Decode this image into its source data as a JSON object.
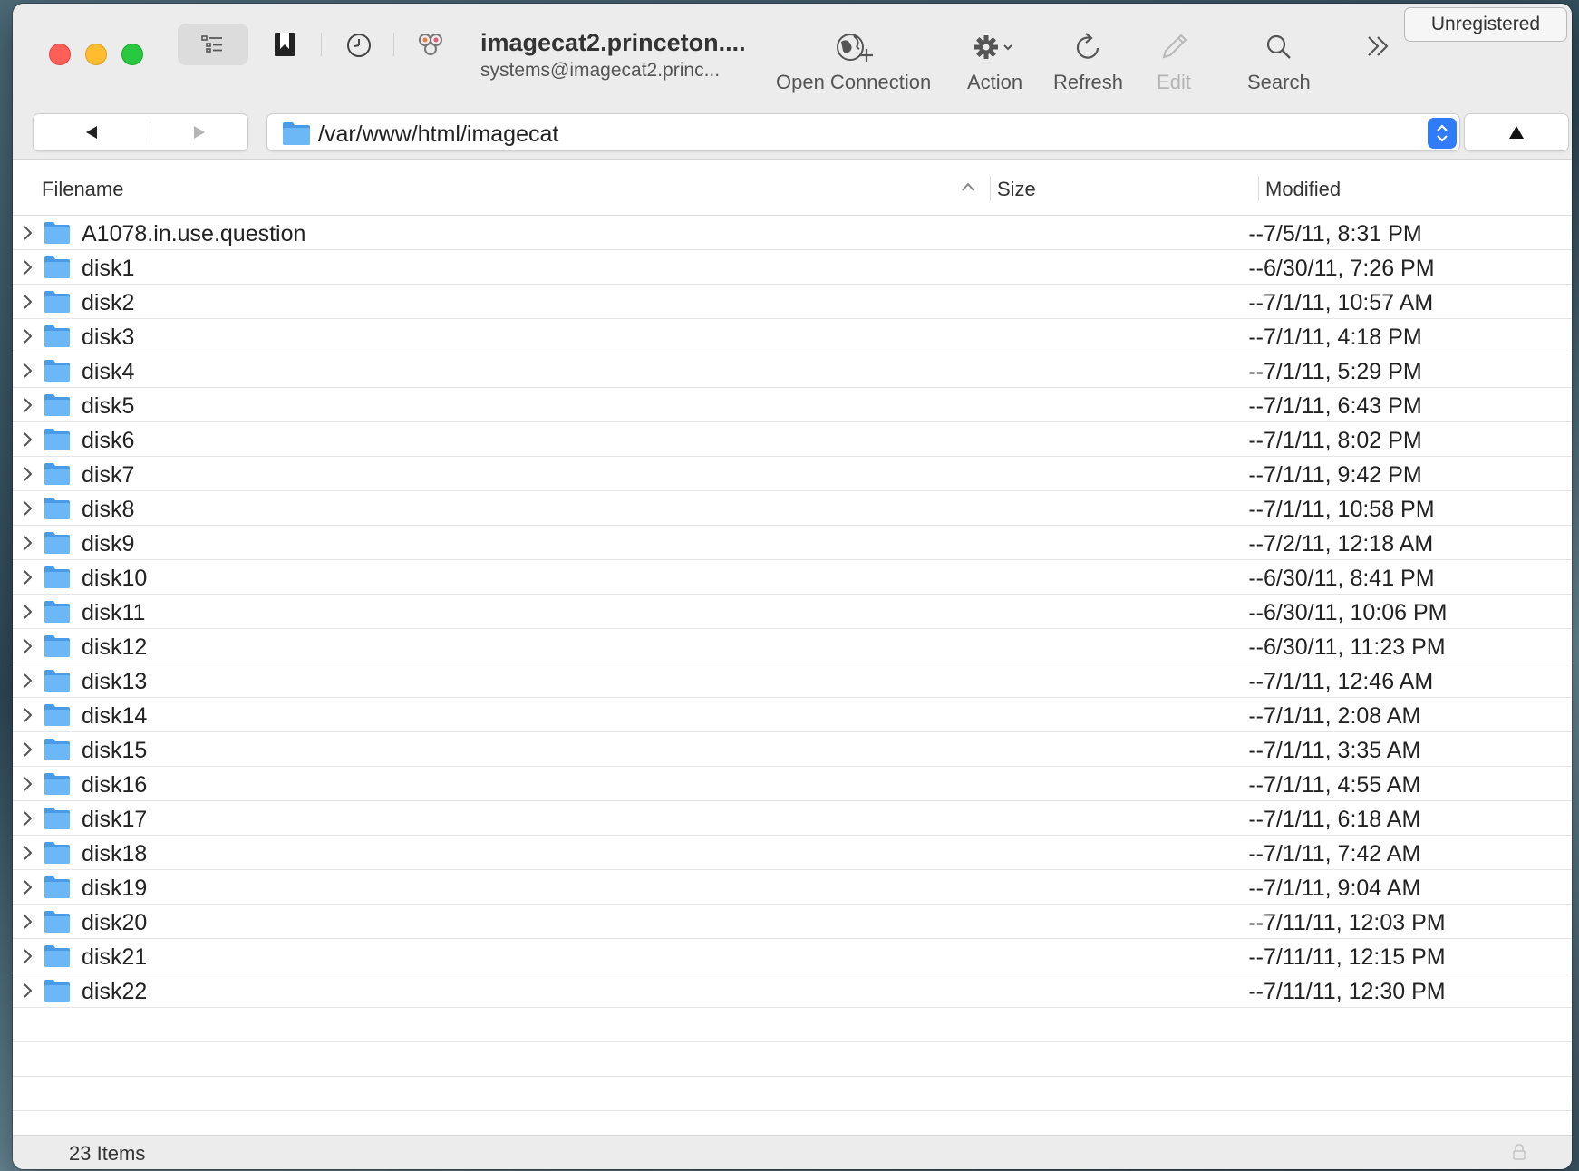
{
  "toolbar": {
    "connection_title": "imagecat2.princeton....",
    "connection_subtitle": "systems@imagecat2.princ...",
    "open_connection_label": "Open Connection",
    "action_label": "Action",
    "refresh_label": "Refresh",
    "edit_label": "Edit",
    "search_label": "Search",
    "unregistered_label": "Unregistered"
  },
  "path": {
    "current": "/var/www/html/imagecat"
  },
  "columns": {
    "filename": "Filename",
    "size": "Size",
    "modified": "Modified"
  },
  "files": [
    {
      "name": "A1078.in.use.question",
      "size": "--",
      "modified": "7/5/11, 8:31 PM"
    },
    {
      "name": "disk1",
      "size": "--",
      "modified": "6/30/11, 7:26 PM"
    },
    {
      "name": "disk2",
      "size": "--",
      "modified": "7/1/11, 10:57 AM"
    },
    {
      "name": "disk3",
      "size": "--",
      "modified": "7/1/11, 4:18 PM"
    },
    {
      "name": "disk4",
      "size": "--",
      "modified": "7/1/11, 5:29 PM"
    },
    {
      "name": "disk5",
      "size": "--",
      "modified": "7/1/11, 6:43 PM"
    },
    {
      "name": "disk6",
      "size": "--",
      "modified": "7/1/11, 8:02 PM"
    },
    {
      "name": "disk7",
      "size": "--",
      "modified": "7/1/11, 9:42 PM"
    },
    {
      "name": "disk8",
      "size": "--",
      "modified": "7/1/11, 10:58 PM"
    },
    {
      "name": "disk9",
      "size": "--",
      "modified": "7/2/11, 12:18 AM"
    },
    {
      "name": "disk10",
      "size": "--",
      "modified": "6/30/11, 8:41 PM"
    },
    {
      "name": "disk11",
      "size": "--",
      "modified": "6/30/11, 10:06 PM"
    },
    {
      "name": "disk12",
      "size": "--",
      "modified": "6/30/11, 11:23 PM"
    },
    {
      "name": "disk13",
      "size": "--",
      "modified": "7/1/11, 12:46 AM"
    },
    {
      "name": "disk14",
      "size": "--",
      "modified": "7/1/11, 2:08 AM"
    },
    {
      "name": "disk15",
      "size": "--",
      "modified": "7/1/11, 3:35 AM"
    },
    {
      "name": "disk16",
      "size": "--",
      "modified": "7/1/11, 4:55 AM"
    },
    {
      "name": "disk17",
      "size": "--",
      "modified": "7/1/11, 6:18 AM"
    },
    {
      "name": "disk18",
      "size": "--",
      "modified": "7/1/11, 7:42 AM"
    },
    {
      "name": "disk19",
      "size": "--",
      "modified": "7/1/11, 9:04 AM"
    },
    {
      "name": "disk20",
      "size": "--",
      "modified": "7/11/11, 12:03 PM"
    },
    {
      "name": "disk21",
      "size": "--",
      "modified": "7/11/11, 12:15 PM"
    },
    {
      "name": "disk22",
      "size": "--",
      "modified": "7/11/11, 12:30 PM"
    }
  ],
  "status": {
    "item_count": "23 Items"
  },
  "icons": {
    "folder": "folder-icon",
    "disclosure": "chevron-right-icon",
    "lock": "lock-icon"
  },
  "colors": {
    "accent": "#2f7cf6",
    "folder": "#5aaaf0"
  }
}
